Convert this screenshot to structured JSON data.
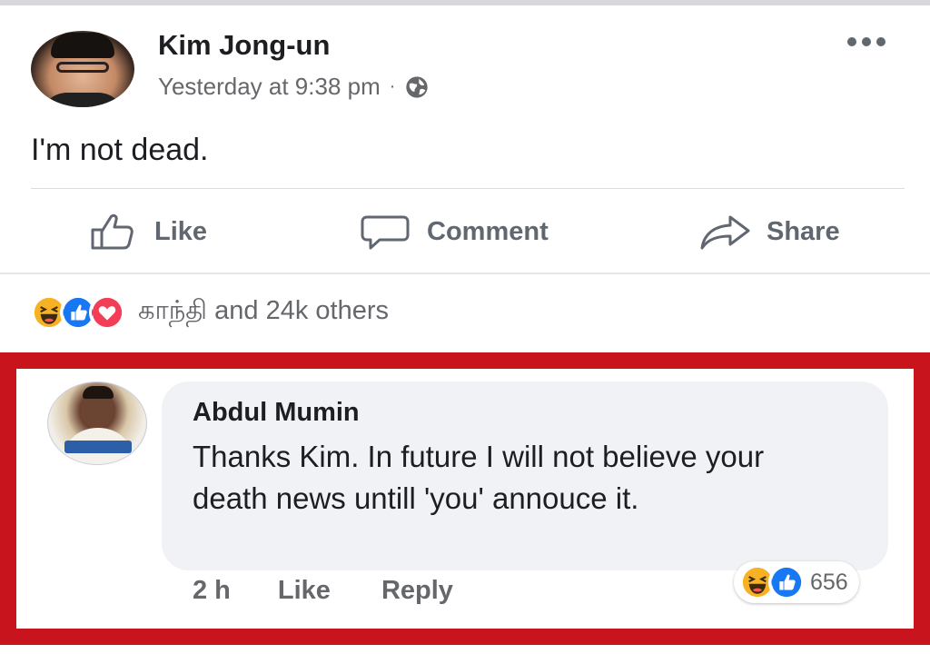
{
  "post": {
    "author": "Kim Jong-un",
    "timestamp": "Yesterday at 9:38 pm",
    "separator": "·",
    "privacy_icon": "globe-icon",
    "text": "I'm not dead."
  },
  "actions": {
    "like_label": "Like",
    "comment_label": "Comment",
    "share_label": "Share"
  },
  "reactions": {
    "icons": [
      "haha-icon",
      "like-icon",
      "love-icon"
    ],
    "summary": "காந்தி and 24k others"
  },
  "comment": {
    "author": "Abdul Mumin",
    "text": "Thanks Kim. In future I will not believe your death news untill 'you' annouce it.",
    "time": "2 h",
    "like_label": "Like",
    "reply_label": "Reply",
    "reaction_icons": [
      "haha-icon",
      "like-icon"
    ],
    "reaction_count": "656"
  },
  "colors": {
    "highlight_border": "#c8141c",
    "like_blue": "#1877f2",
    "love_red": "#f33e58",
    "haha_yellow": "#f7b125",
    "secondary_text": "#65676b"
  }
}
